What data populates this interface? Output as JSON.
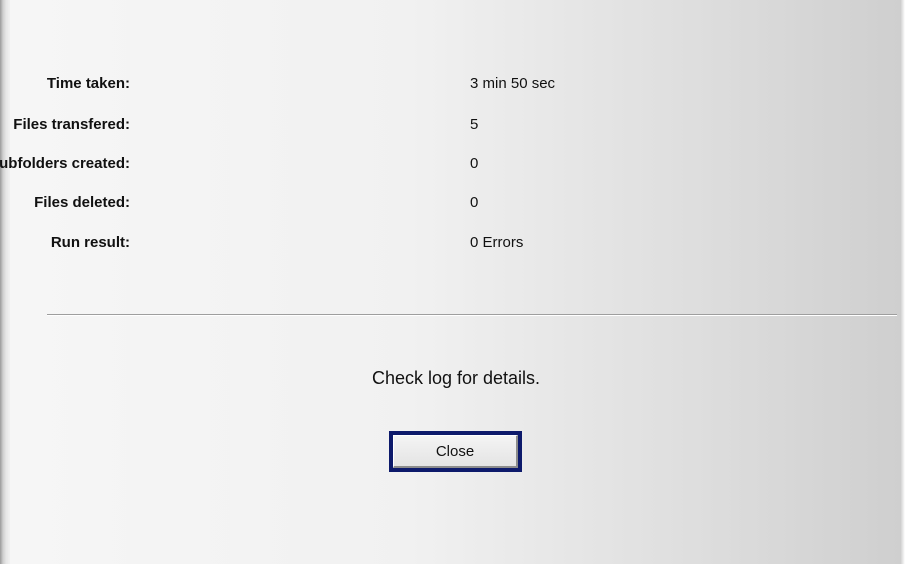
{
  "summary": {
    "rows": [
      {
        "label": "Time taken:",
        "value": "3 min 50 sec"
      },
      {
        "label": "Files transfered:",
        "value": "5"
      },
      {
        "label": "Subfolders created:",
        "value": "0"
      },
      {
        "label": "Files deleted:",
        "value": "0"
      },
      {
        "label": "Run result:",
        "value": "0 Errors"
      }
    ]
  },
  "message": "Check log for details.",
  "buttons": {
    "close_label": "Close"
  },
  "colors": {
    "button_focus_border": "#0d1a6b",
    "text": "#111111"
  }
}
